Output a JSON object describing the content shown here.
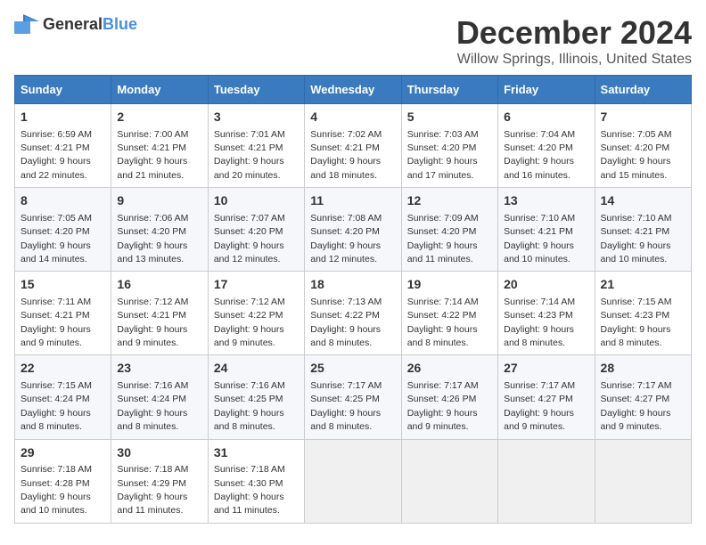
{
  "logo": {
    "general": "General",
    "blue": "Blue"
  },
  "title": "December 2024",
  "location": "Willow Springs, Illinois, United States",
  "headers": [
    "Sunday",
    "Monday",
    "Tuesday",
    "Wednesday",
    "Thursday",
    "Friday",
    "Saturday"
  ],
  "weeks": [
    [
      {
        "day": "1",
        "info": "Sunrise: 6:59 AM\nSunset: 4:21 PM\nDaylight: 9 hours\nand 22 minutes."
      },
      {
        "day": "2",
        "info": "Sunrise: 7:00 AM\nSunset: 4:21 PM\nDaylight: 9 hours\nand 21 minutes."
      },
      {
        "day": "3",
        "info": "Sunrise: 7:01 AM\nSunset: 4:21 PM\nDaylight: 9 hours\nand 20 minutes."
      },
      {
        "day": "4",
        "info": "Sunrise: 7:02 AM\nSunset: 4:21 PM\nDaylight: 9 hours\nand 18 minutes."
      },
      {
        "day": "5",
        "info": "Sunrise: 7:03 AM\nSunset: 4:20 PM\nDaylight: 9 hours\nand 17 minutes."
      },
      {
        "day": "6",
        "info": "Sunrise: 7:04 AM\nSunset: 4:20 PM\nDaylight: 9 hours\nand 16 minutes."
      },
      {
        "day": "7",
        "info": "Sunrise: 7:05 AM\nSunset: 4:20 PM\nDaylight: 9 hours\nand 15 minutes."
      }
    ],
    [
      {
        "day": "8",
        "info": "Sunrise: 7:05 AM\nSunset: 4:20 PM\nDaylight: 9 hours\nand 14 minutes."
      },
      {
        "day": "9",
        "info": "Sunrise: 7:06 AM\nSunset: 4:20 PM\nDaylight: 9 hours\nand 13 minutes."
      },
      {
        "day": "10",
        "info": "Sunrise: 7:07 AM\nSunset: 4:20 PM\nDaylight: 9 hours\nand 12 minutes."
      },
      {
        "day": "11",
        "info": "Sunrise: 7:08 AM\nSunset: 4:20 PM\nDaylight: 9 hours\nand 12 minutes."
      },
      {
        "day": "12",
        "info": "Sunrise: 7:09 AM\nSunset: 4:20 PM\nDaylight: 9 hours\nand 11 minutes."
      },
      {
        "day": "13",
        "info": "Sunrise: 7:10 AM\nSunset: 4:21 PM\nDaylight: 9 hours\nand 10 minutes."
      },
      {
        "day": "14",
        "info": "Sunrise: 7:10 AM\nSunset: 4:21 PM\nDaylight: 9 hours\nand 10 minutes."
      }
    ],
    [
      {
        "day": "15",
        "info": "Sunrise: 7:11 AM\nSunset: 4:21 PM\nDaylight: 9 hours\nand 9 minutes."
      },
      {
        "day": "16",
        "info": "Sunrise: 7:12 AM\nSunset: 4:21 PM\nDaylight: 9 hours\nand 9 minutes."
      },
      {
        "day": "17",
        "info": "Sunrise: 7:12 AM\nSunset: 4:22 PM\nDaylight: 9 hours\nand 9 minutes."
      },
      {
        "day": "18",
        "info": "Sunrise: 7:13 AM\nSunset: 4:22 PM\nDaylight: 9 hours\nand 8 minutes."
      },
      {
        "day": "19",
        "info": "Sunrise: 7:14 AM\nSunset: 4:22 PM\nDaylight: 9 hours\nand 8 minutes."
      },
      {
        "day": "20",
        "info": "Sunrise: 7:14 AM\nSunset: 4:23 PM\nDaylight: 9 hours\nand 8 minutes."
      },
      {
        "day": "21",
        "info": "Sunrise: 7:15 AM\nSunset: 4:23 PM\nDaylight: 9 hours\nand 8 minutes."
      }
    ],
    [
      {
        "day": "22",
        "info": "Sunrise: 7:15 AM\nSunset: 4:24 PM\nDaylight: 9 hours\nand 8 minutes."
      },
      {
        "day": "23",
        "info": "Sunrise: 7:16 AM\nSunset: 4:24 PM\nDaylight: 9 hours\nand 8 minutes."
      },
      {
        "day": "24",
        "info": "Sunrise: 7:16 AM\nSunset: 4:25 PM\nDaylight: 9 hours\nand 8 minutes."
      },
      {
        "day": "25",
        "info": "Sunrise: 7:17 AM\nSunset: 4:25 PM\nDaylight: 9 hours\nand 8 minutes."
      },
      {
        "day": "26",
        "info": "Sunrise: 7:17 AM\nSunset: 4:26 PM\nDaylight: 9 hours\nand 9 minutes."
      },
      {
        "day": "27",
        "info": "Sunrise: 7:17 AM\nSunset: 4:27 PM\nDaylight: 9 hours\nand 9 minutes."
      },
      {
        "day": "28",
        "info": "Sunrise: 7:17 AM\nSunset: 4:27 PM\nDaylight: 9 hours\nand 9 minutes."
      }
    ],
    [
      {
        "day": "29",
        "info": "Sunrise: 7:18 AM\nSunset: 4:28 PM\nDaylight: 9 hours\nand 10 minutes."
      },
      {
        "day": "30",
        "info": "Sunrise: 7:18 AM\nSunset: 4:29 PM\nDaylight: 9 hours\nand 11 minutes."
      },
      {
        "day": "31",
        "info": "Sunrise: 7:18 AM\nSunset: 4:30 PM\nDaylight: 9 hours\nand 11 minutes."
      },
      null,
      null,
      null,
      null
    ]
  ]
}
